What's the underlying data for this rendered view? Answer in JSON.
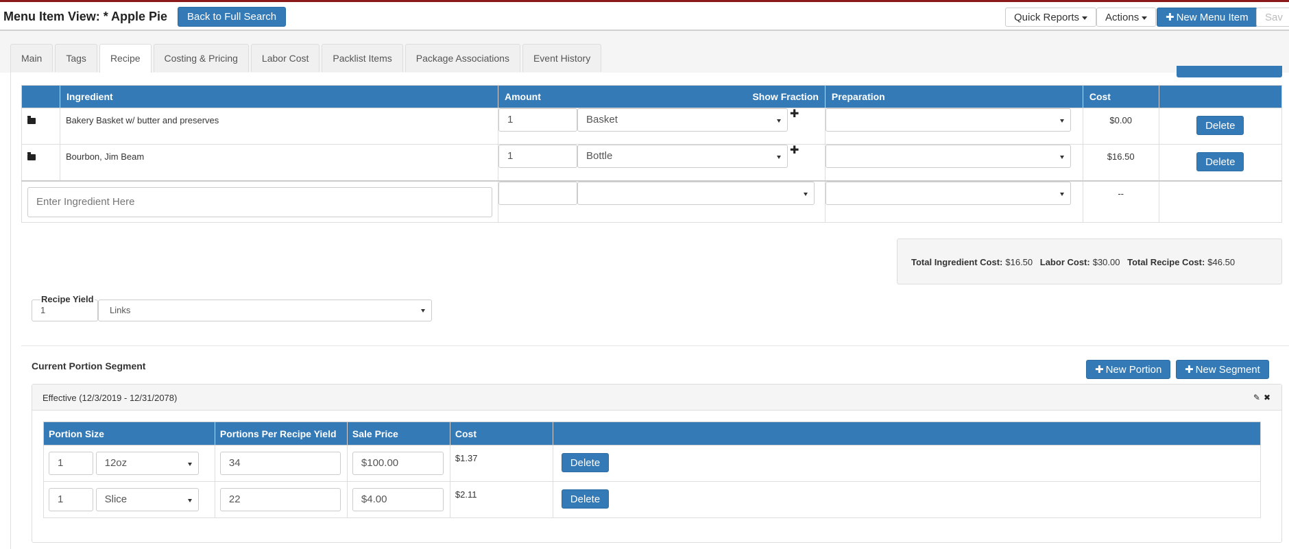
{
  "header": {
    "title": "Menu Item View: * Apple Pie",
    "back_label": "Back to Full Search",
    "quick_reports_label": "Quick Reports",
    "actions_label": "Actions",
    "new_menu_item_label": "New Menu Item",
    "save_label": "Sav"
  },
  "tabs": [
    {
      "label": "Main"
    },
    {
      "label": "Tags"
    },
    {
      "label": "Recipe",
      "active": true
    },
    {
      "label": "Costing & Pricing"
    },
    {
      "label": "Labor Cost"
    },
    {
      "label": "Packlist Items"
    },
    {
      "label": "Package Associations"
    },
    {
      "label": "Event History"
    }
  ],
  "ingredients": {
    "columns": {
      "ingredient": "Ingredient",
      "amount": "Amount",
      "show_fraction": "Show Fraction",
      "preparation": "Preparation",
      "cost": "Cost"
    },
    "rows": [
      {
        "name": "Bakery Basket w/ butter and preserves",
        "amount": "1",
        "unit": "Basket",
        "preparation": "",
        "cost": "$0.00",
        "delete_label": "Delete"
      },
      {
        "name": "Bourbon, Jim Beam",
        "amount": "1",
        "unit": "Bottle",
        "preparation": "",
        "cost": "$16.50",
        "delete_label": "Delete"
      }
    ],
    "entry": {
      "placeholder": "Enter Ingredient Here",
      "cost": "--"
    }
  },
  "totals": {
    "ingredient_label": "Total Ingredient Cost:",
    "ingredient_value": "$16.50",
    "labor_label": "Labor Cost:",
    "labor_value": "$30.00",
    "recipe_label": "Total Recipe Cost:",
    "recipe_value": "$46.50"
  },
  "yield": {
    "label": "Recipe Yield",
    "quantity": "1",
    "unit": "Links"
  },
  "segment": {
    "title": "Current Portion Segment",
    "new_portion_label": "New Portion",
    "new_segment_label": "New Segment",
    "effective": "Effective (12/3/2019 - 12/31/2078)",
    "columns": {
      "portion_size": "Portion Size",
      "portions_per_yield": "Portions Per Recipe Yield",
      "sale_price": "Sale Price",
      "cost": "Cost"
    },
    "rows": [
      {
        "qty": "1",
        "unit": "12oz",
        "portions": "34",
        "price": "$100.00",
        "cost": "$1.37",
        "delete_label": "Delete"
      },
      {
        "qty": "1",
        "unit": "Slice",
        "portions": "22",
        "price": "$4.00",
        "cost": "$2.11",
        "delete_label": "Delete"
      }
    ]
  },
  "icons": {
    "folder": "folder-open-icon",
    "plus": "plus-icon",
    "pencil": "pencil-icon",
    "close": "close-icon",
    "caret": "caret-down-icon"
  },
  "colors": {
    "primary": "#337ab7",
    "top_accent": "#8b1a1a"
  }
}
